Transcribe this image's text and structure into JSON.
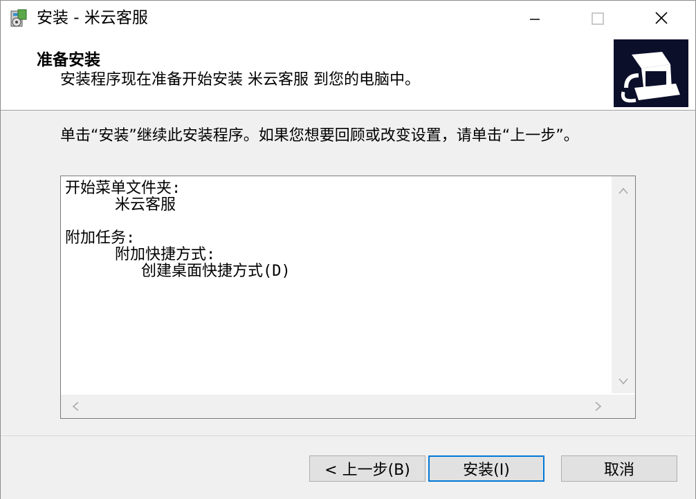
{
  "window": {
    "title": "安装 - 米云客服"
  },
  "header": {
    "title": "准备安装",
    "subtitle": "安装程序现在准备开始安装 米云客服 到您的电脑中。"
  },
  "body": {
    "instruction": "单击“安装”继续此安装程序。如果您想要回顾或改变设置，请单击“上一步”。",
    "memo_lines": [
      "开始菜单文件夹:",
      "米云客服",
      "",
      "附加任务:",
      "附加快捷方式:",
      "创建桌面快捷方式(D)"
    ]
  },
  "buttons": {
    "back": "< 上一步(B)",
    "install": "安装(I)",
    "cancel": "取消"
  },
  "icons": {
    "app": "installer-icon",
    "header": "computer-setup-icon",
    "minimize": "minimize-icon",
    "maximize": "maximize-icon",
    "close": "close-icon",
    "scroll_up": "chevron-up-icon",
    "scroll_down": "chevron-down-icon",
    "scroll_left": "chevron-left-icon",
    "scroll_right": "chevron-right-icon"
  },
  "colors": {
    "default_button_border": "#0078d7",
    "header_image_bg": "#0c0f2a"
  }
}
